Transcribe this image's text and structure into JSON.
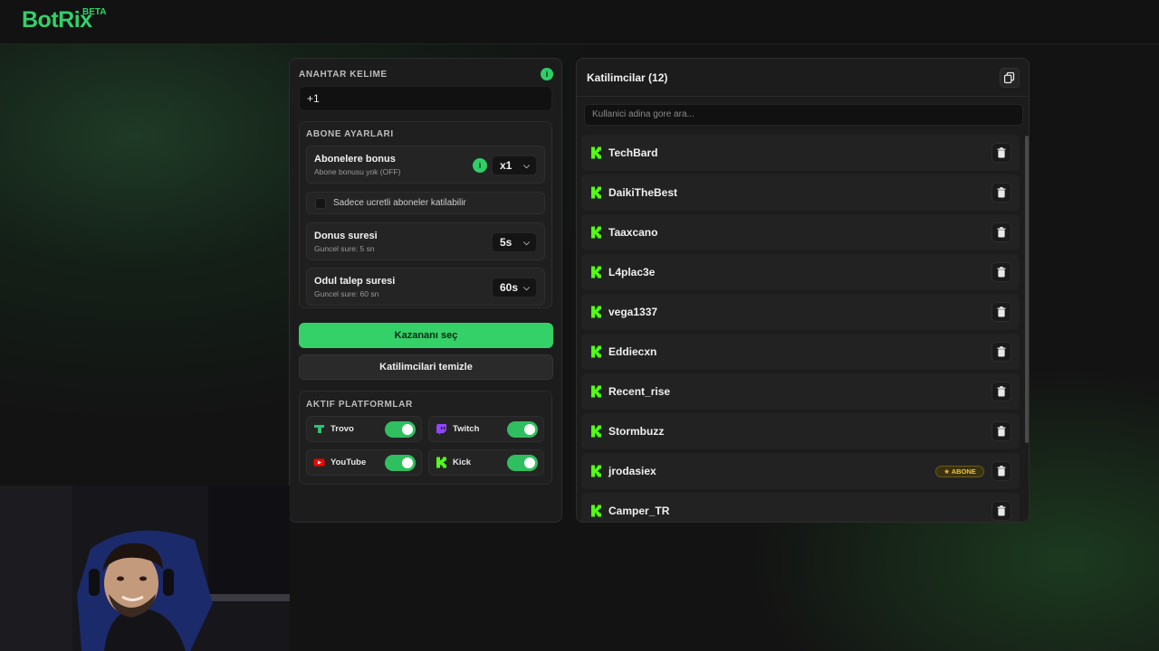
{
  "header": {
    "logo": "BotRix",
    "logo_badge": "BETA"
  },
  "left": {
    "keyword_label": "ANAHTAR KELIME",
    "keyword_info": "i",
    "keyword_value": "+1",
    "sub_settings_label": "ABONE AYARLARI",
    "sub_bonus_title": "Abonelere bonus",
    "sub_bonus_desc": "Abone bonusu yok (OFF)",
    "sub_bonus_info": "i",
    "sub_bonus_value": "x1",
    "paid_only_label": "Sadece ucretli aboneler katilabilir",
    "duration_title": "Donus suresi",
    "duration_desc": "Guncel sure: 5 sn",
    "duration_value": "5s",
    "claim_title": "Odul talep suresi",
    "claim_desc": "Guncel sure: 60 sn",
    "claim_value": "60s",
    "pick_winner": "Kazananı seç",
    "clear_participants": "Katilimcilari temizle",
    "platforms_label": "AKTIF PLATFORMLAR",
    "platforms": [
      {
        "name": "Trovo",
        "icon": "trovo-icon",
        "color": "#2cc274",
        "enabled": true
      },
      {
        "name": "Twitch",
        "icon": "twitch-icon",
        "color": "#9146ff",
        "enabled": true
      },
      {
        "name": "YouTube",
        "icon": "youtube-icon",
        "color": "#ff0000",
        "enabled": true
      },
      {
        "name": "Kick",
        "icon": "kick-icon",
        "color": "#53fc18",
        "enabled": true
      }
    ]
  },
  "right": {
    "title": "Katilimcilar (12)",
    "search_placeholder": "Kullanici adina gore ara...",
    "badge_label": "ABONE",
    "participants": [
      {
        "name": "TechBard",
        "subscriber": false
      },
      {
        "name": "DaikiTheBest",
        "subscriber": false
      },
      {
        "name": "Taaxcano",
        "subscriber": false
      },
      {
        "name": "L4plac3e",
        "subscriber": false
      },
      {
        "name": "vega1337",
        "subscriber": false
      },
      {
        "name": "Eddiecxn",
        "subscriber": false
      },
      {
        "name": "Recent_rise",
        "subscriber": false
      },
      {
        "name": "Stormbuzz",
        "subscriber": false
      },
      {
        "name": "jrodasiex",
        "subscriber": true
      },
      {
        "name": "Camper_TR",
        "subscriber": false
      }
    ]
  },
  "colors": {
    "accent": "#34d068",
    "background": "#131313",
    "panel": "#1c1c1c",
    "kick": "#53fc18",
    "badge": "#f0c233"
  }
}
